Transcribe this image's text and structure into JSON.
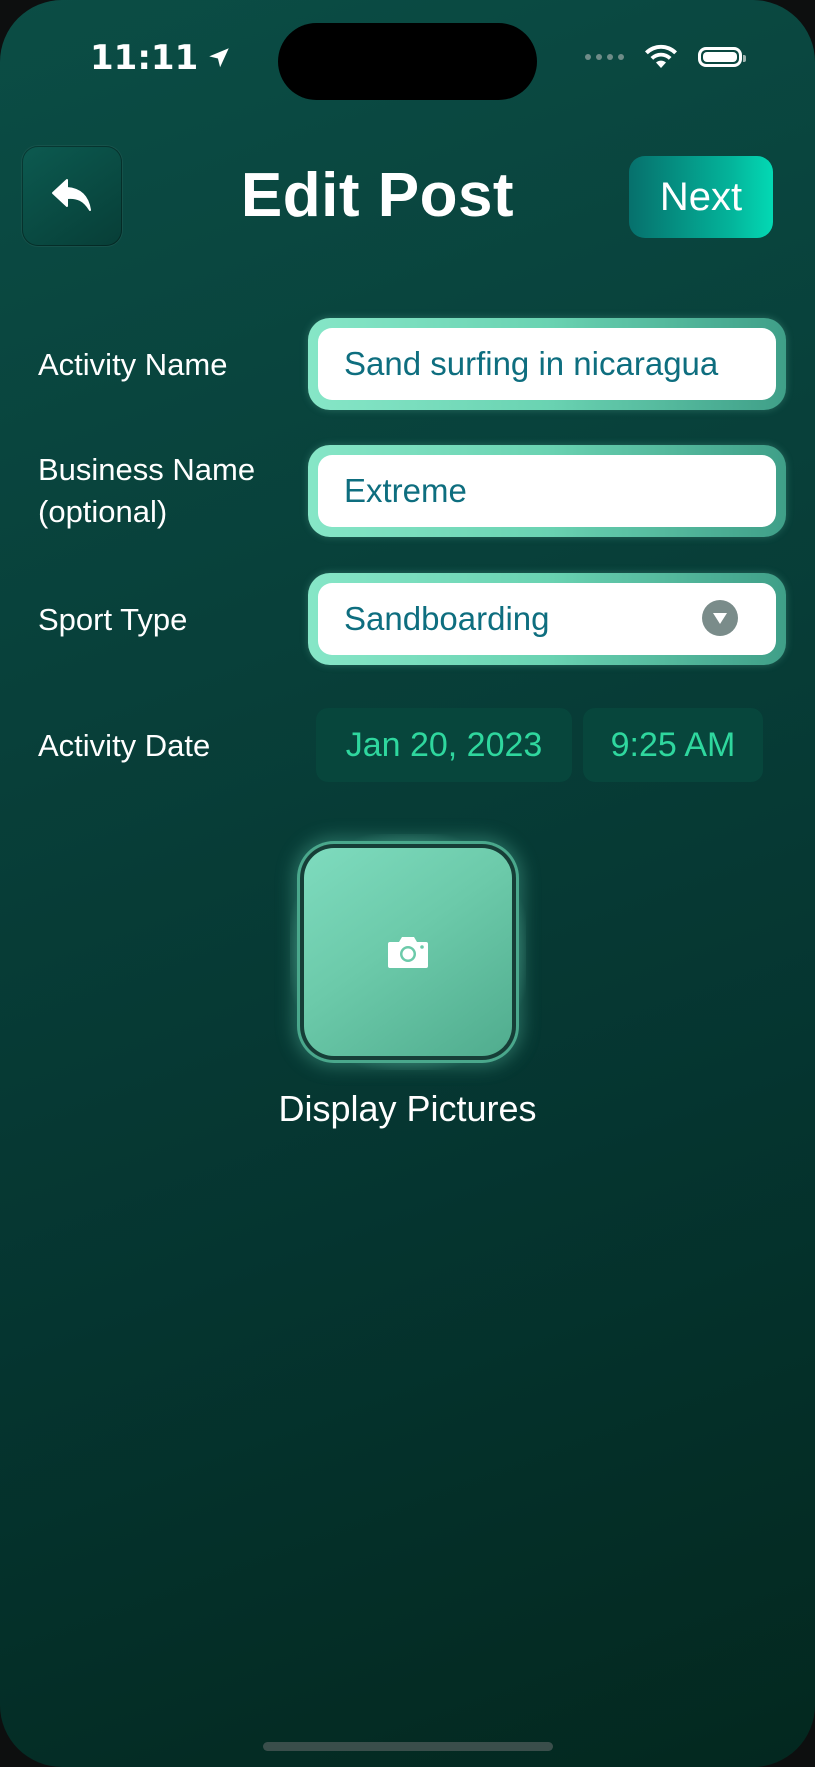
{
  "status_bar": {
    "time": "11:11",
    "location_icon": "location-arrow-icon",
    "signal_icon": "cellular-dots-icon",
    "wifi_icon": "wifi-icon",
    "battery_icon": "battery-icon"
  },
  "header": {
    "back_icon": "reply-arrow-icon",
    "title": "Edit Post",
    "next_label": "Next"
  },
  "form": {
    "activity_name": {
      "label": "Activity Name",
      "value": "Sand surfing in nicaragua"
    },
    "business_name": {
      "label_line1": "Business Name",
      "label_line2": "(optional)",
      "value": "Extreme"
    },
    "sport_type": {
      "label": "Sport Type",
      "value": "Sandboarding"
    },
    "activity_date": {
      "label": "Activity Date",
      "date": "Jan 20, 2023",
      "time": "9:25 AM"
    }
  },
  "pictures": {
    "icon": "camera-icon",
    "label": "Display Pictures"
  },
  "colors": {
    "background_top": "#0b4d45",
    "background_bottom": "#03281f",
    "accent": "#2fd79e",
    "field_text": "#0e6e7f",
    "next_gradient_end": "#03d9b4"
  }
}
